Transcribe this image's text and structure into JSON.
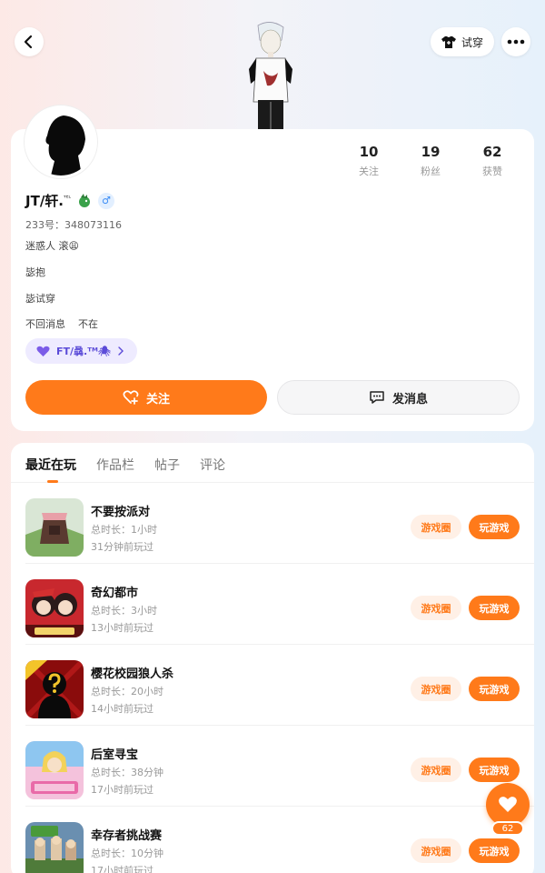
{
  "header": {
    "tryon_label": "试穿"
  },
  "profile": {
    "name": "JT/轩.",
    "name_suffix": "ᵀᴱᴸ",
    "gender_symbol": "♂",
    "uid": "233号：348073116",
    "bio_lines": [
      "迷惑人 滚😩",
      "毖抱",
      "毖试穿",
      "不回消息    不在"
    ],
    "stats": [
      {
        "num": "10",
        "label": "关注"
      },
      {
        "num": "19",
        "label": "粉丝"
      },
      {
        "num": "62",
        "label": "获赞"
      }
    ],
    "tag": "FT/骉.ᵀᴹ🕷",
    "follow_label": "关注",
    "message_label": "发消息"
  },
  "tabs": [
    {
      "label": "最近在玩",
      "active": true
    },
    {
      "label": "作品栏",
      "active": false
    },
    {
      "label": "帖子",
      "active": false
    },
    {
      "label": "评论",
      "active": false
    }
  ],
  "games": [
    {
      "title": "不要按派对",
      "duration": "总时长：1小时",
      "last_played": "31分钟前玩过",
      "thumb_color": "#6a8f5a"
    },
    {
      "title": "奇幻都市",
      "duration": "总时长：3小时",
      "last_played": "13小时前玩过",
      "thumb_color": "#c8282e"
    },
    {
      "title": "樱花校园狼人杀",
      "duration": "总时长：20小时",
      "last_played": "14小时前玩过",
      "thumb_color": "#b01818"
    },
    {
      "title": "后室寻宝",
      "duration": "总时长：38分钟",
      "last_played": "17小时前玩过",
      "thumb_color": "#e9a3c9"
    },
    {
      "title": "幸存者挑战赛",
      "duration": "总时长：10分钟",
      "last_played": "17小时前玩过",
      "thumb_color": "#4f7b3a"
    }
  ],
  "buttons": {
    "circle_label": "游戏圈",
    "play_label": "玩游戏"
  },
  "like": {
    "count": "62"
  },
  "colors": {
    "accent": "#ff7a1a",
    "tag_bg": "#eeebff"
  }
}
